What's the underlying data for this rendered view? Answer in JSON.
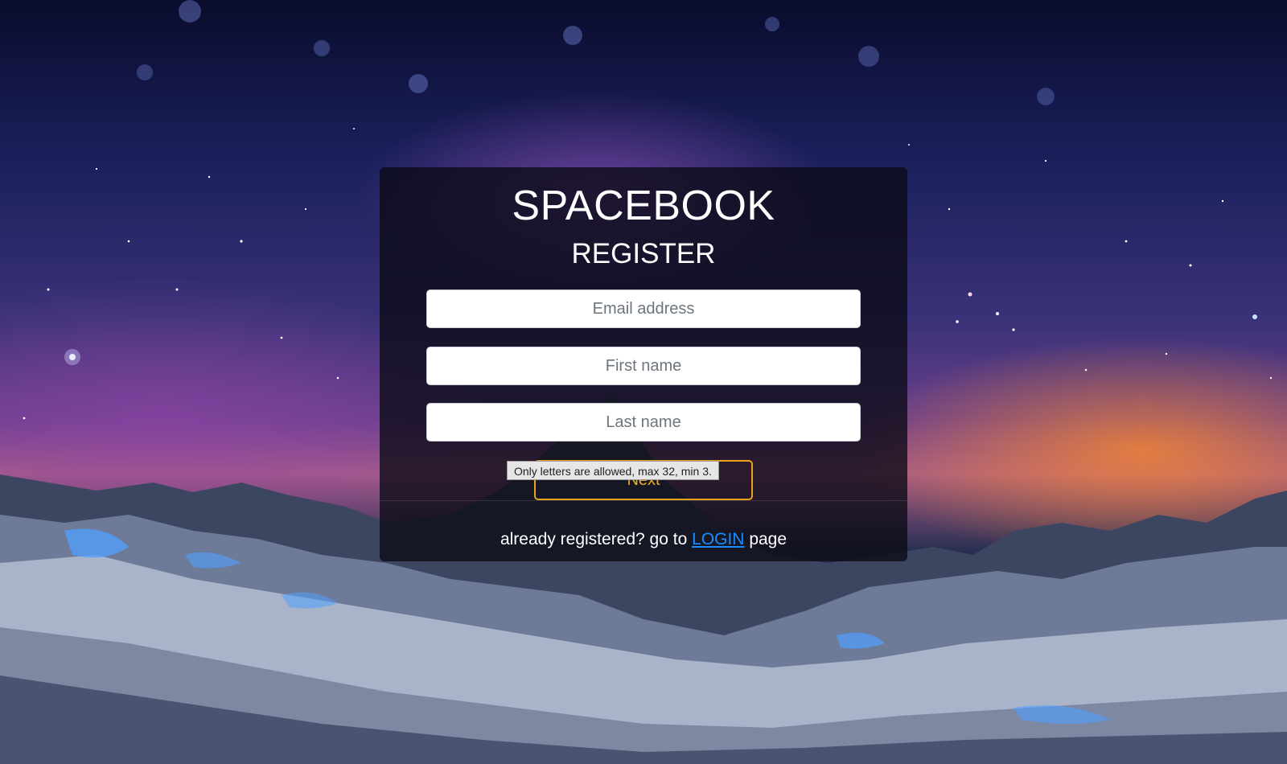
{
  "app": {
    "brand": "SPACEBOOK"
  },
  "register_form": {
    "title": "REGISTER",
    "email_placeholder": "Email address",
    "first_name_placeholder": "First name",
    "last_name_placeholder": "Last name",
    "next_label": "Next",
    "validation_tooltip": "Only letters are allowed, max 32, min 3."
  },
  "footer": {
    "prefix": "already registered? go to",
    "login_link": "LOGIN",
    "suffix": "page"
  },
  "colors": {
    "button_accent": "#e8a317",
    "link": "#1a8cff"
  },
  "background": {
    "icon": "starry-mountain-background"
  }
}
